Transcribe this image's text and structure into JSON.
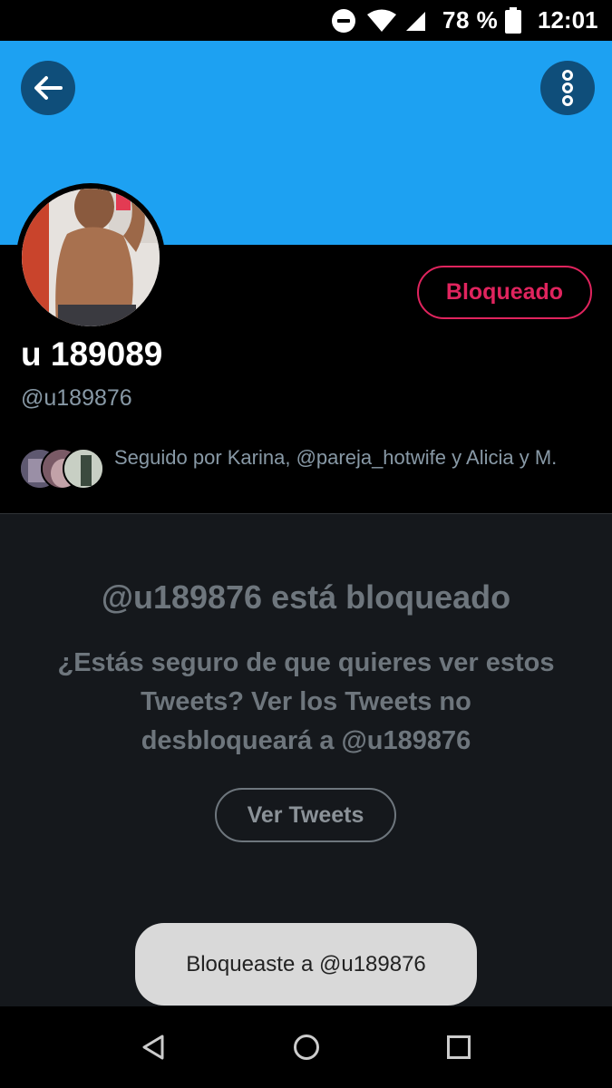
{
  "status_bar": {
    "battery": "78 %",
    "time": "12:01"
  },
  "header": {
    "back_icon": "arrow-left-icon",
    "more_icon": "more-vertical-icon",
    "banner_color": "#1da1f2"
  },
  "profile": {
    "display_name": "u 189089",
    "handle": "@u189876",
    "blocked_button_label": "Bloqueado",
    "followed_by": "Seguido por Karina, @pareja_hotwife y Alicia y M.",
    "accent_color": "#e0245e"
  },
  "blocked_notice": {
    "title": "@u189876 está bloqueado",
    "body": "¿Estás seguro de que quieres ver estos Tweets? Ver los Tweets no desbloqueará a @u189876",
    "view_button_label": "Ver Tweets"
  },
  "toast": {
    "message": "Bloqueaste a @u189876"
  },
  "nav_bar": {
    "back_icon": "triangle-back-icon",
    "home_icon": "circle-home-icon",
    "recents_icon": "square-recents-icon"
  }
}
